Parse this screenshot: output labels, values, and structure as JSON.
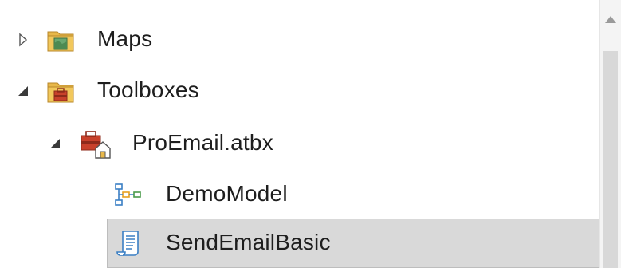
{
  "tree": {
    "items": [
      {
        "label": "Maps",
        "expanded": false,
        "icon": "map-folder-icon"
      },
      {
        "label": "Toolboxes",
        "expanded": true,
        "icon": "toolbox-folder-icon"
      },
      {
        "label": "ProEmail.atbx",
        "expanded": true,
        "icon": "toolbox-icon"
      },
      {
        "label": "DemoModel",
        "icon": "model-icon"
      },
      {
        "label": "SendEmailBasic",
        "icon": "script-icon",
        "selected": true
      }
    ]
  },
  "colors": {
    "folder": "#e8b84a",
    "folder_dark": "#c9962b",
    "toolbox_red": "#c8412b",
    "selection": "#d9d9d9",
    "model_blue": "#3a7fc4",
    "model_green": "#4a9a4a"
  }
}
